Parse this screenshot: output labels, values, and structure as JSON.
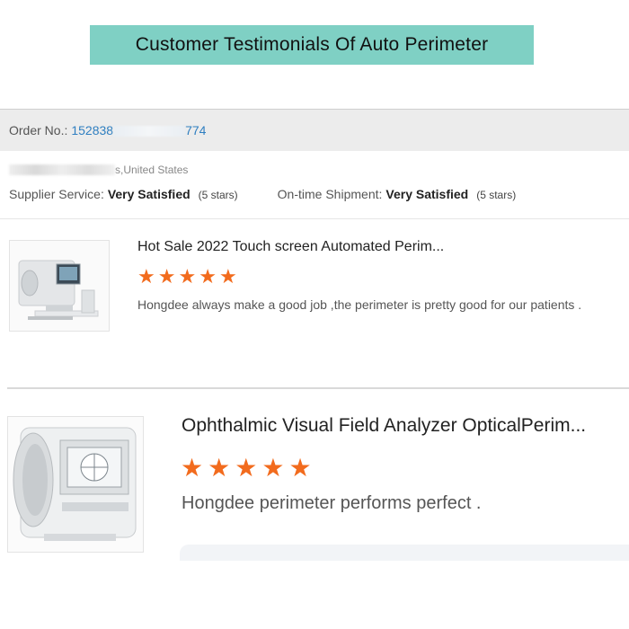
{
  "banner": {
    "title": "Customer Testimonials Of Auto Perimeter"
  },
  "order": {
    "label": "Order No.:",
    "number_start": "152838",
    "number_end": "774"
  },
  "location": {
    "country": "s,United States"
  },
  "ratings": {
    "supplier_label": "Supplier Service:",
    "supplier_value": "Very Satisfied",
    "supplier_stars": "(5 stars)",
    "shipment_label": "On-time Shipment:",
    "shipment_value": "Very Satisfied",
    "shipment_stars": "(5 stars)"
  },
  "reviews": [
    {
      "product_title": "Hot Sale 2022 Touch screen Automated Perim...",
      "stars": 5,
      "comment": "Hongdee always make a good job ,the perimeter is pretty good for our patients ."
    },
    {
      "product_title": "Ophthalmic Visual Field Analyzer OpticalPerim...",
      "stars": 5,
      "comment": "Hongdee perimeter performs perfect ."
    }
  ],
  "colors": {
    "banner": "#7fd0c4",
    "star": "#f26b1d",
    "order_link": "#2f7fc1"
  },
  "icons": {
    "star": "star-icon",
    "product_image": "perimeter-device-image"
  }
}
